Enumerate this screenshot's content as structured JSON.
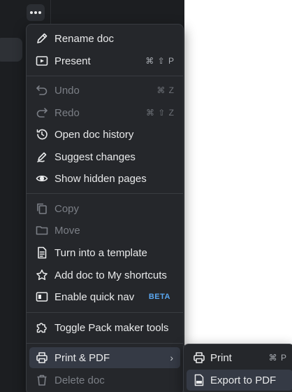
{
  "menu": {
    "items": [
      {
        "label": "Rename doc",
        "icon": "pencil-icon"
      },
      {
        "label": "Present",
        "icon": "present-icon",
        "shortcut": "⌘ ⇧ P"
      },
      {
        "label": "Undo",
        "icon": "undo-icon",
        "shortcut": "⌘ Z",
        "disabled": true
      },
      {
        "label": "Redo",
        "icon": "redo-icon",
        "shortcut": "⌘ ⇧ Z",
        "disabled": true
      },
      {
        "label": "Open doc history",
        "icon": "history-icon"
      },
      {
        "label": "Suggest changes",
        "icon": "suggest-icon"
      },
      {
        "label": "Show hidden pages",
        "icon": "eye-icon"
      },
      {
        "label": "Copy",
        "icon": "copy-icon",
        "disabled": true
      },
      {
        "label": "Move",
        "icon": "folder-icon",
        "disabled": true
      },
      {
        "label": "Turn into a template",
        "icon": "template-icon"
      },
      {
        "label": "Add doc to My shortcuts",
        "icon": "star-icon"
      },
      {
        "label": "Enable quick nav",
        "icon": "quick-nav-icon",
        "badge": "BETA"
      },
      {
        "label": "Toggle Pack maker tools",
        "icon": "puzzle-icon"
      },
      {
        "label": "Print & PDF",
        "icon": "printer-icon",
        "submenu_indicator": "›"
      },
      {
        "label": "Delete doc",
        "icon": "trash-icon",
        "disabled": true
      }
    ]
  },
  "submenu": {
    "items": [
      {
        "label": "Print",
        "icon": "printer-icon",
        "shortcut": "⌘ P"
      },
      {
        "label": "Export to PDF",
        "icon": "pdf-file-icon"
      }
    ]
  },
  "colors": {
    "menu_bg": "#25272b",
    "hover_bg": "#353a45",
    "badge": "#5aa7f0"
  }
}
